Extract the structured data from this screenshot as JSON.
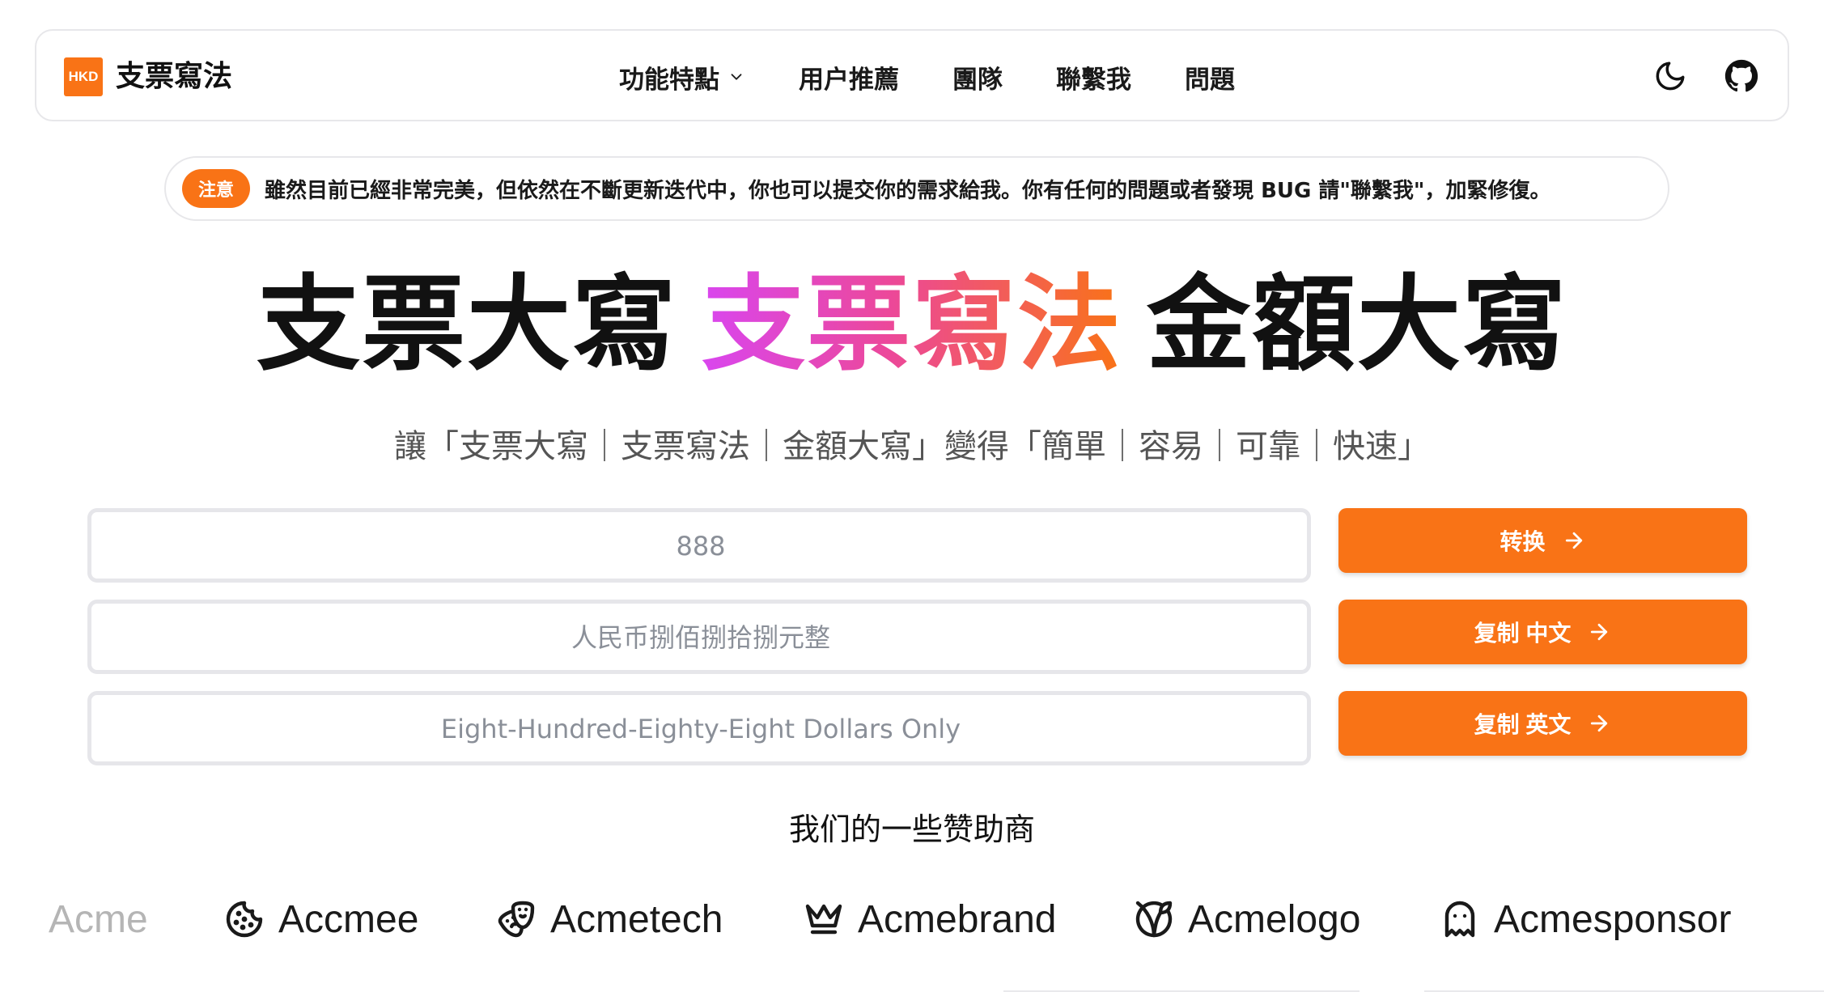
{
  "brand": {
    "logo_text": "HKD",
    "name": "支票寫法",
    "accent": "#f97316"
  },
  "nav": {
    "links": [
      {
        "label": "功能特點",
        "has_dropdown": true
      },
      {
        "label": "用户推薦"
      },
      {
        "label": "團隊"
      },
      {
        "label": "聯繫我"
      },
      {
        "label": "問題"
      }
    ],
    "icons": [
      "moon-icon",
      "github-icon"
    ]
  },
  "notice": {
    "badge": "注意",
    "text": "雖然目前已經非常完美，但依然在不斷更新迭代中，你也可以提交你的需求給我。你有任何的問題或者發現 BUG 請\"聯繫我\"，加緊修復。"
  },
  "hero": {
    "part1": "支票大寫",
    "part2": "支票寫法",
    "part3": "金額大寫",
    "gradient": [
      "#d946ef",
      "#ec4899",
      "#f97316"
    ]
  },
  "subtitle": "讓「支票大寫｜支票寫法｜金額大寫」變得「簡單｜容易｜可靠｜快速」",
  "converter": {
    "amount_placeholder": "888",
    "chinese_placeholder": "人民币捌佰捌拾捌元整",
    "english_placeholder": "Eight-Hundred-Eighty-Eight Dollars Only",
    "convert_button": "转换",
    "copy_chinese_button": "复制 中文",
    "copy_english_button": "复制 英文"
  },
  "sponsors": {
    "title": "我们的一些赞助商",
    "items": [
      {
        "name": "Acme",
        "icon": "none"
      },
      {
        "name": "Accmee",
        "icon": "cookie-icon"
      },
      {
        "name": "Acmetech",
        "icon": "drama-mask-icon"
      },
      {
        "name": "Acmebrand",
        "icon": "crown-icon"
      },
      {
        "name": "Acmelogo",
        "icon": "vegan-leaf-icon"
      },
      {
        "name": "Acmesponsor",
        "icon": "ghost-icon"
      }
    ]
  }
}
